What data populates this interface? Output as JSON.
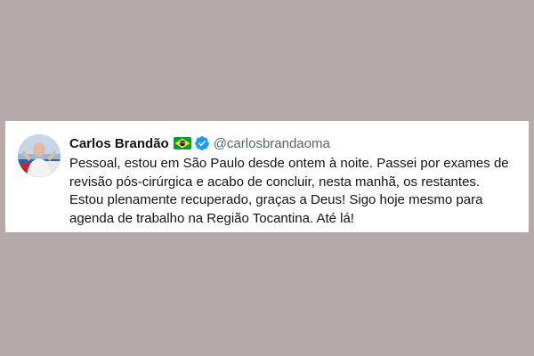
{
  "tweet": {
    "display_name": "Carlos Brandão",
    "handle": "@carlosbrandaoma",
    "flag_icon": "brazil-flag-icon",
    "verified_icon": "verified-badge-icon",
    "verified_color": "#1d9bf0",
    "text": "Pessoal, estou em São Paulo desde ontem à noite. Passei por exames de revisão pós-cirúrgica e acabo de concluir, nesta manhã, os restantes. Estou plenamente recuperado, graças a Deus! Sigo hoje mesmo para agenda de trabalho na Região Tocantina. Até lá!"
  }
}
